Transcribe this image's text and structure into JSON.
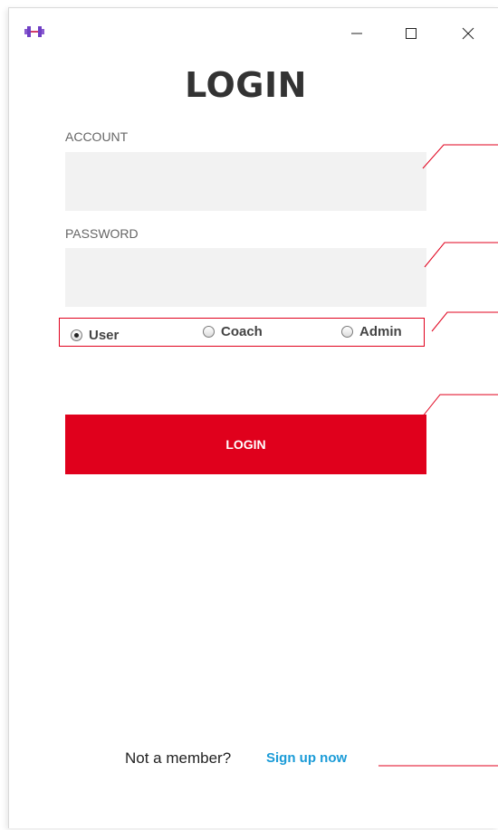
{
  "window": {
    "icon": "dumbbell-icon",
    "controls": {
      "minimize": "minimize-icon",
      "maximize": "maximize-icon",
      "close": "close-icon"
    }
  },
  "header": {
    "title": "LOGIN"
  },
  "form": {
    "account_label": "ACCOUNT",
    "account_value": "",
    "password_label": "PASSWORD",
    "password_value": "",
    "roles": [
      {
        "label": "User",
        "checked": true
      },
      {
        "label": "Coach",
        "checked": false
      },
      {
        "label": "Admin",
        "checked": false
      }
    ],
    "login_button": "LOGIN"
  },
  "footer": {
    "prompt": "Not a member?",
    "signup_link": "Sign up now"
  },
  "colors": {
    "accent": "#e0001c",
    "link": "#1a9bd7",
    "input_bg": "#f2f2f2",
    "annotation": "#e0001c"
  }
}
